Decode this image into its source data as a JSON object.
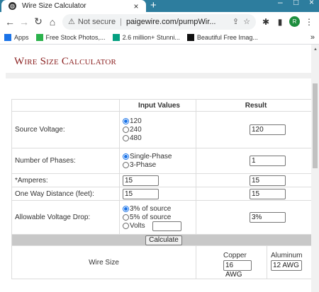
{
  "browser": {
    "tab_title": "Wire Size Calculator",
    "tab_close": "×",
    "new_tab": "+",
    "win_min": "–",
    "win_max": "□",
    "win_close": "×",
    "security_label": "Not secure",
    "separator": "|",
    "url": "paigewire.com/pumpWir...",
    "profile_initial": "R",
    "bookmarks": [
      {
        "label": "Apps",
        "color": "#1a73e8"
      },
      {
        "label": "Free Stock Photos,...",
        "color": "#2bb24c"
      },
      {
        "label": "2.6 million+ Stunni...",
        "color": "#05a081"
      },
      {
        "label": "Beautiful Free Imag...",
        "color": "#111111"
      }
    ],
    "bookmarks_more": "»",
    "icons": [
      "back-icon",
      "forward-icon",
      "reload-icon",
      "home-icon",
      "warning-icon",
      "share-icon",
      "star-icon",
      "puzzle-icon",
      "sidepanel-icon",
      "menu-icon"
    ]
  },
  "page": {
    "title": "Wire Size Calculator",
    "headers": {
      "label": "",
      "input": "Input Values",
      "result": "Result"
    },
    "rows": {
      "voltage": {
        "label": "Source Voltage:",
        "options": [
          "120",
          "240",
          "480"
        ],
        "selected": "120",
        "result": "120"
      },
      "phases": {
        "label": "Number of Phases:",
        "options": [
          "Single-Phase",
          "3-Phase"
        ],
        "selected": "Single-Phase",
        "result": "1"
      },
      "amperes": {
        "label": "*Amperes:",
        "value": "15",
        "result": "15"
      },
      "distance": {
        "label": "One Way Distance (feet):",
        "value": "15",
        "result": "15"
      },
      "drop": {
        "label": "Allowable Voltage Drop:",
        "options": [
          "3% of source",
          "5% of source",
          "Volts"
        ],
        "selected": "3% of source",
        "volts_value": "",
        "result": "3%"
      }
    },
    "calculate_label": "Calculate",
    "wire_size": {
      "label": "Wire Size",
      "copper_label": "Copper",
      "copper_value": "16 AWG",
      "aluminum_label": "Aluminum",
      "aluminum_value": "12 AWG"
    }
  }
}
